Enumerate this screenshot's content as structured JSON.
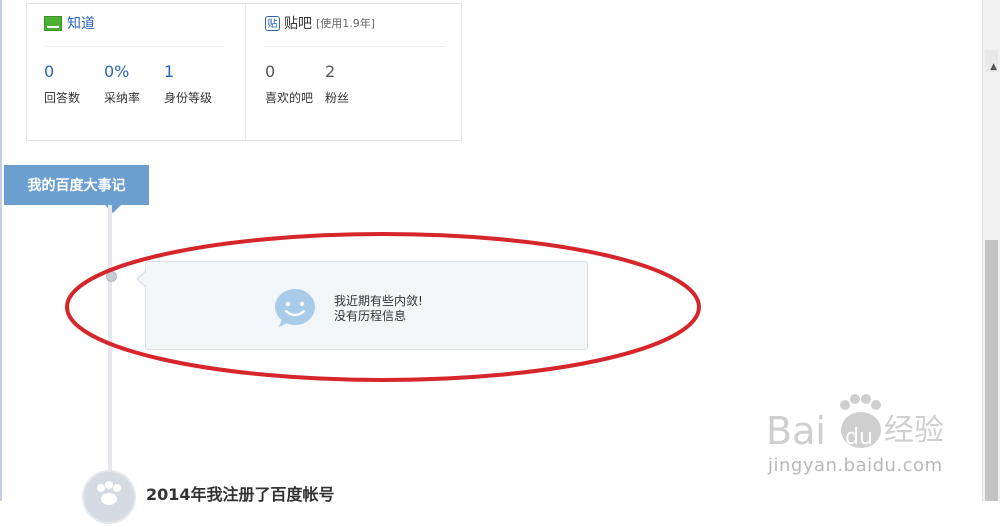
{
  "stats": {
    "zhidao": {
      "title": "知道",
      "items": [
        {
          "value": "0",
          "label": "回答数"
        },
        {
          "value": "0%",
          "label": "采纳率"
        },
        {
          "value": "1",
          "label": "身份等级"
        }
      ]
    },
    "tieba": {
      "title": "贴吧",
      "icon_char": "贴",
      "note": "[使用1.9年]",
      "items": [
        {
          "value": "0",
          "label": "喜欢的吧"
        },
        {
          "value": "2",
          "label": "粉丝"
        }
      ]
    }
  },
  "milestones": {
    "tab_label": "我的百度大事记",
    "empty_message": {
      "line1": "我近期有些内敛!",
      "line2": "没有历程信息"
    },
    "registered_title": "2014年我注册了百度帐号"
  },
  "watermark": {
    "brand": "Bai",
    "brand_suffix": "du",
    "product": "经验",
    "url": "jingyan.baidu.com"
  },
  "colors": {
    "accent_blue": "#2d66b8",
    "tab_blue": "#6b9fd0",
    "annotation_red": "#d6252b"
  }
}
